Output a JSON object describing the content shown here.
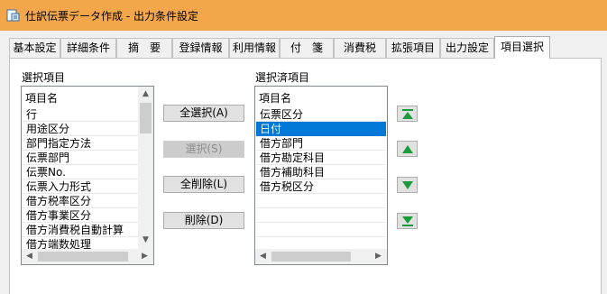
{
  "window": {
    "title": "仕訳伝票データ作成 - 出力条件設定"
  },
  "tabs": [
    {
      "label": "基本設定",
      "active": false
    },
    {
      "label": "詳細条件",
      "active": false
    },
    {
      "label": "摘　要",
      "active": false
    },
    {
      "label": "登録情報",
      "active": false
    },
    {
      "label": "利用情報",
      "active": false
    },
    {
      "label": "付　箋",
      "active": false
    },
    {
      "label": "消費税",
      "active": false
    },
    {
      "label": "拡張項目",
      "active": false
    },
    {
      "label": "出力設定",
      "active": false
    },
    {
      "label": "項目選択",
      "active": true
    }
  ],
  "available": {
    "label": "選択項目",
    "column_header": "項目名",
    "items": [
      "行",
      "用途区分",
      "部門指定方法",
      "伝票部門",
      "伝票No.",
      "伝票入力形式",
      "借方税率区分",
      "借方事業区分",
      "借方消費税自動計算",
      "借方端数処理"
    ]
  },
  "buttons": {
    "select_all": "全選択(A)",
    "select": "選択(S)",
    "delete_all": "全削除(L)",
    "delete": "削除(D)"
  },
  "selected": {
    "label": "選択済項目",
    "column_header": "項目名",
    "items": [
      "伝票区分",
      "日付",
      "借方部門",
      "借方勘定科目",
      "借方補助科目",
      "借方税区分"
    ],
    "selected_index": 1
  },
  "move_buttons": {
    "top_icon": "move-top-icon",
    "up_icon": "move-up-icon",
    "down_icon": "move-down-icon",
    "bottom_icon": "move-bottom-icon"
  },
  "colors": {
    "titlebar": "#f4a64a",
    "selection": "#0078d7",
    "arrow_green": "#1a9b3c"
  }
}
